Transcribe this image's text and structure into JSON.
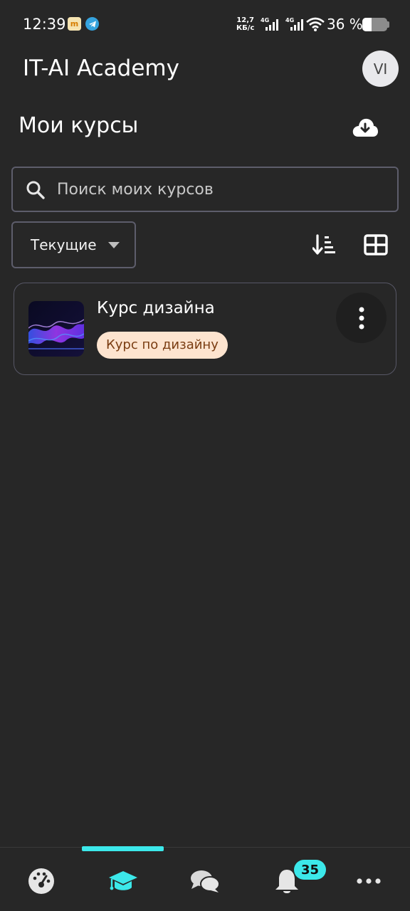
{
  "status_bar": {
    "time": "12:39",
    "net_speed_value": "12,7",
    "net_speed_unit": "КБ/с",
    "signal1_label": "4G",
    "signal2_label": "4G",
    "battery_percent": "36 %",
    "battery_level": 0.36
  },
  "header": {
    "app_title": "IT-AI Academy",
    "avatar_initials": "VI"
  },
  "page": {
    "title": "Мои курсы"
  },
  "search": {
    "placeholder": "Поиск моих курсов",
    "value": ""
  },
  "filter": {
    "selected": "Текущие"
  },
  "courses": [
    {
      "title": "Курс дизайна",
      "category": "Курс по дизайну"
    }
  ],
  "bottom_nav": {
    "items": [
      "dashboard-icon",
      "courses-icon",
      "messages-icon",
      "notifications-icon",
      "more-icon"
    ],
    "active": "courses-icon",
    "notifications_count": "35"
  },
  "colors": {
    "background": "#272727",
    "accent": "#3ce8ea",
    "badge_bg": "#fde4cf",
    "badge_text": "#7a3d12"
  }
}
